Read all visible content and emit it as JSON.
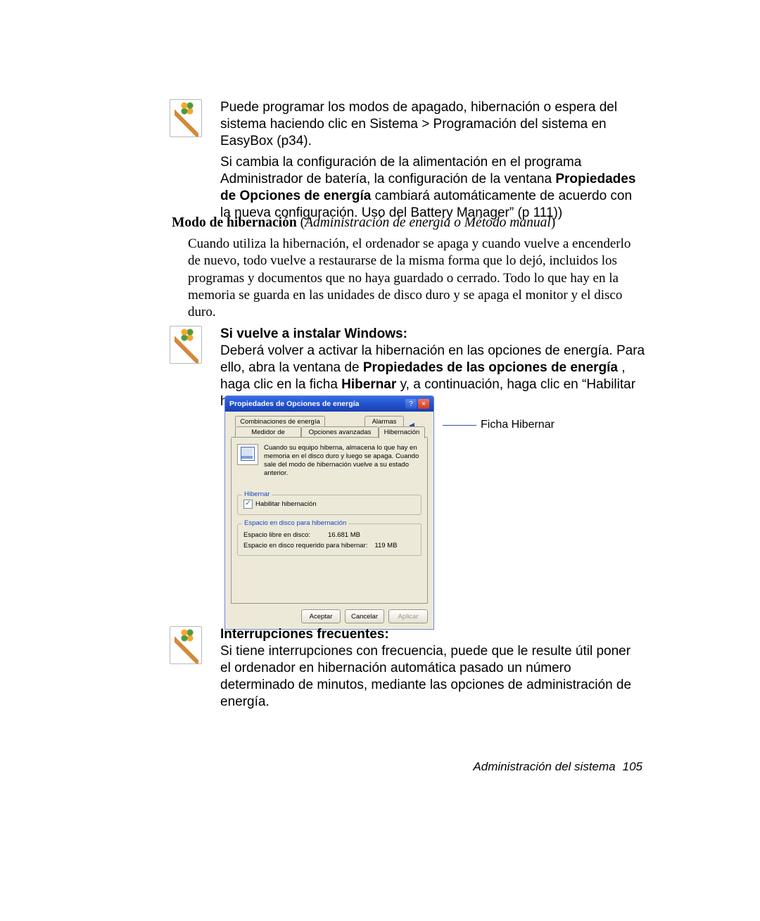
{
  "note1": {
    "p1": "Puede programar los modos de apagado, hibernación o espera del sistema haciendo clic en Sistema > Programación del sistema en EasyBox (p34).",
    "p2_a": "Si cambia la configuración de la alimentación en el programa Administrador de batería, la configuración de la ventana ",
    "p2_b": "Propiedades de Opciones de energía",
    "p2_c": " cambiará automáticamente de acuerdo con la nueva configuración. Uso del Battery Manager” (p 111))"
  },
  "mode_heading": {
    "bold": "Modo de hibernación",
    "ital": "Administración de energía o Método manual"
  },
  "mode_para": "Cuando utiliza la hibernación, el ordenador se apaga y cuando vuelve a encenderlo de nuevo, todo vuelve a restaurarse de la misma forma que lo dejó, incluidos los programas y documentos que no haya guardado o cerrado. Todo lo que hay en la memoria se guarda en las unidades de disco duro y se apaga el monitor y el disco duro.",
  "note2": {
    "h": "Si vuelve a instalar Windows:",
    "a": "Deberá volver a activar la hibernación en las opciones de energía. Para ello, abra la ventana de ",
    "b": "Propiedades de las opciones de energía",
    "c": " , haga clic en la ficha ",
    "d": "Hibernar",
    "e": " y, a continuación, haga clic en “Habilitar hibernación”."
  },
  "dialog": {
    "title": "Propiedades de Opciones de energía",
    "help": "?",
    "close": "×",
    "tabs": {
      "t1": "Combinaciones de energía",
      "t2": "Alarmas",
      "t3": "Medidor de energía",
      "t4": "Opciones avanzadas",
      "t5": "Hibernación"
    },
    "desc": "Cuando su equipo hiberna, almacena lo que hay en memoria en el disco duro y luego se apaga. Cuando sale del modo de hibernación vuelve a su estado anterior.",
    "grp1_legend": "Hibernar",
    "chk_label": "Habilitar hibernación",
    "grp2_legend": "Espacio en disco para hibernación",
    "free_label": "Espacio libre en disco:",
    "free_val": "16.681 MB",
    "req_label": "Espacio en disco requerido para hibernar:",
    "req_val": "119 MB",
    "btn_ok": "Aceptar",
    "btn_cancel": "Cancelar",
    "btn_apply": "Aplicar"
  },
  "callout": "Ficha Hibernar",
  "note3": {
    "h": "Interrupciones frecuentes:",
    "body": "Si tiene interrupciones con frecuencia, puede que le resulte útil poner el ordenador en hibernación automática pasado un número determinado de minutos, mediante las opciones de administración de energía."
  },
  "footer_label": "Administración del sistema",
  "footer_page": "105"
}
